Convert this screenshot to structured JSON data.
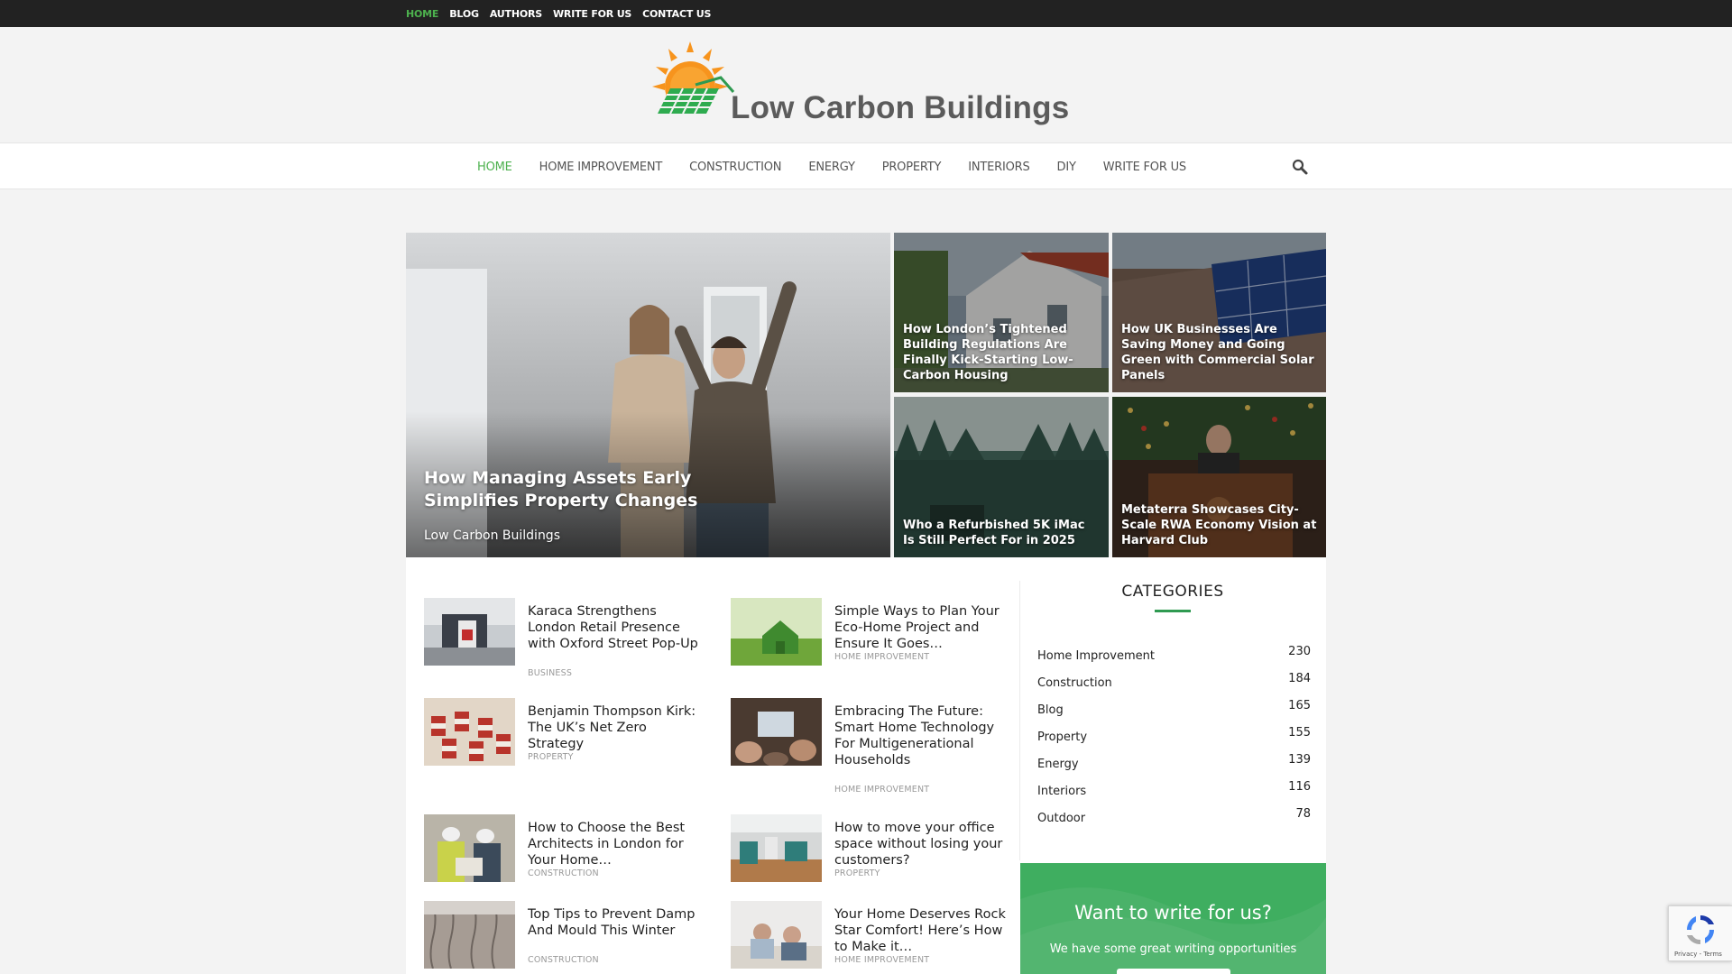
{
  "topbar": {
    "links": [
      "HOME",
      "BLOG",
      "AUTHORS",
      "WRITE FOR US",
      "CONTACT US"
    ]
  },
  "site": {
    "name": "Low Carbon Buildings"
  },
  "nav": {
    "items": [
      "HOME",
      "HOME IMPROVEMENT",
      "CONSTRUCTION",
      "ENERGY",
      "PROPERTY",
      "INTERIORS",
      "DIY",
      "WRITE FOR US"
    ]
  },
  "hero": {
    "main_title": "How Managing Assets Early Simplifies Property Changes",
    "main_author": "Low Carbon Buildings",
    "tiles": [
      "How London’s Tightened Building Regulations Are Finally Kick-Starting Low-Carbon Housing",
      "How UK Businesses Are Saving Money and Going Green with Commercial Solar Panels",
      "Who a Refurbished 5K iMac Is Still Perfect For in 2025",
      "Metaterra Showcases City-Scale RWA Economy Vision at Harvard Club"
    ]
  },
  "posts": [
    {
      "title": "Karaca Strengthens London Retail Presence with Oxford Street Pop-Up",
      "category": "BUSINESS"
    },
    {
      "title": "Simple Ways to Plan Your Eco-Home Project and Ensure It Goes…",
      "category": "HOME IMPROVEMENT"
    },
    {
      "title": "Benjamin Thompson Kirk: The UK’s Net Zero Strategy",
      "category": "PROPERTY"
    },
    {
      "title": "Embracing The Future: Smart Home Technology For Multigenerational Households",
      "category": "HOME IMPROVEMENT"
    },
    {
      "title": "How to Choose the Best Architects in London for Your Home…",
      "category": "CONSTRUCTION"
    },
    {
      "title": "How to move your office space without losing your customers?",
      "category": "PROPERTY"
    },
    {
      "title": "Top Tips to Prevent Damp And Mould This Winter",
      "category": "CONSTRUCTION"
    },
    {
      "title": "Your Home Deserves Rock Star Comfort! Here’s How to Make it…",
      "category": "HOME IMPROVEMENT"
    }
  ],
  "sidebar": {
    "categories_title": "CATEGORIES",
    "categories": [
      {
        "name": "Home Improvement",
        "count": "230"
      },
      {
        "name": "Construction",
        "count": "184"
      },
      {
        "name": "Blog",
        "count": "165"
      },
      {
        "name": "Property",
        "count": "155"
      },
      {
        "name": "Energy",
        "count": "139"
      },
      {
        "name": "Interiors",
        "count": "116"
      },
      {
        "name": "Outdoor",
        "count": "78"
      }
    ],
    "write_box": {
      "heading": "Want to write for us?",
      "text": "We have some great writing opportunities"
    }
  },
  "recaptcha": {
    "text": "Privacy - Terms"
  },
  "colors": {
    "accent": "#4db14e",
    "topbar": "#222222",
    "write_box": "#3fae60"
  }
}
